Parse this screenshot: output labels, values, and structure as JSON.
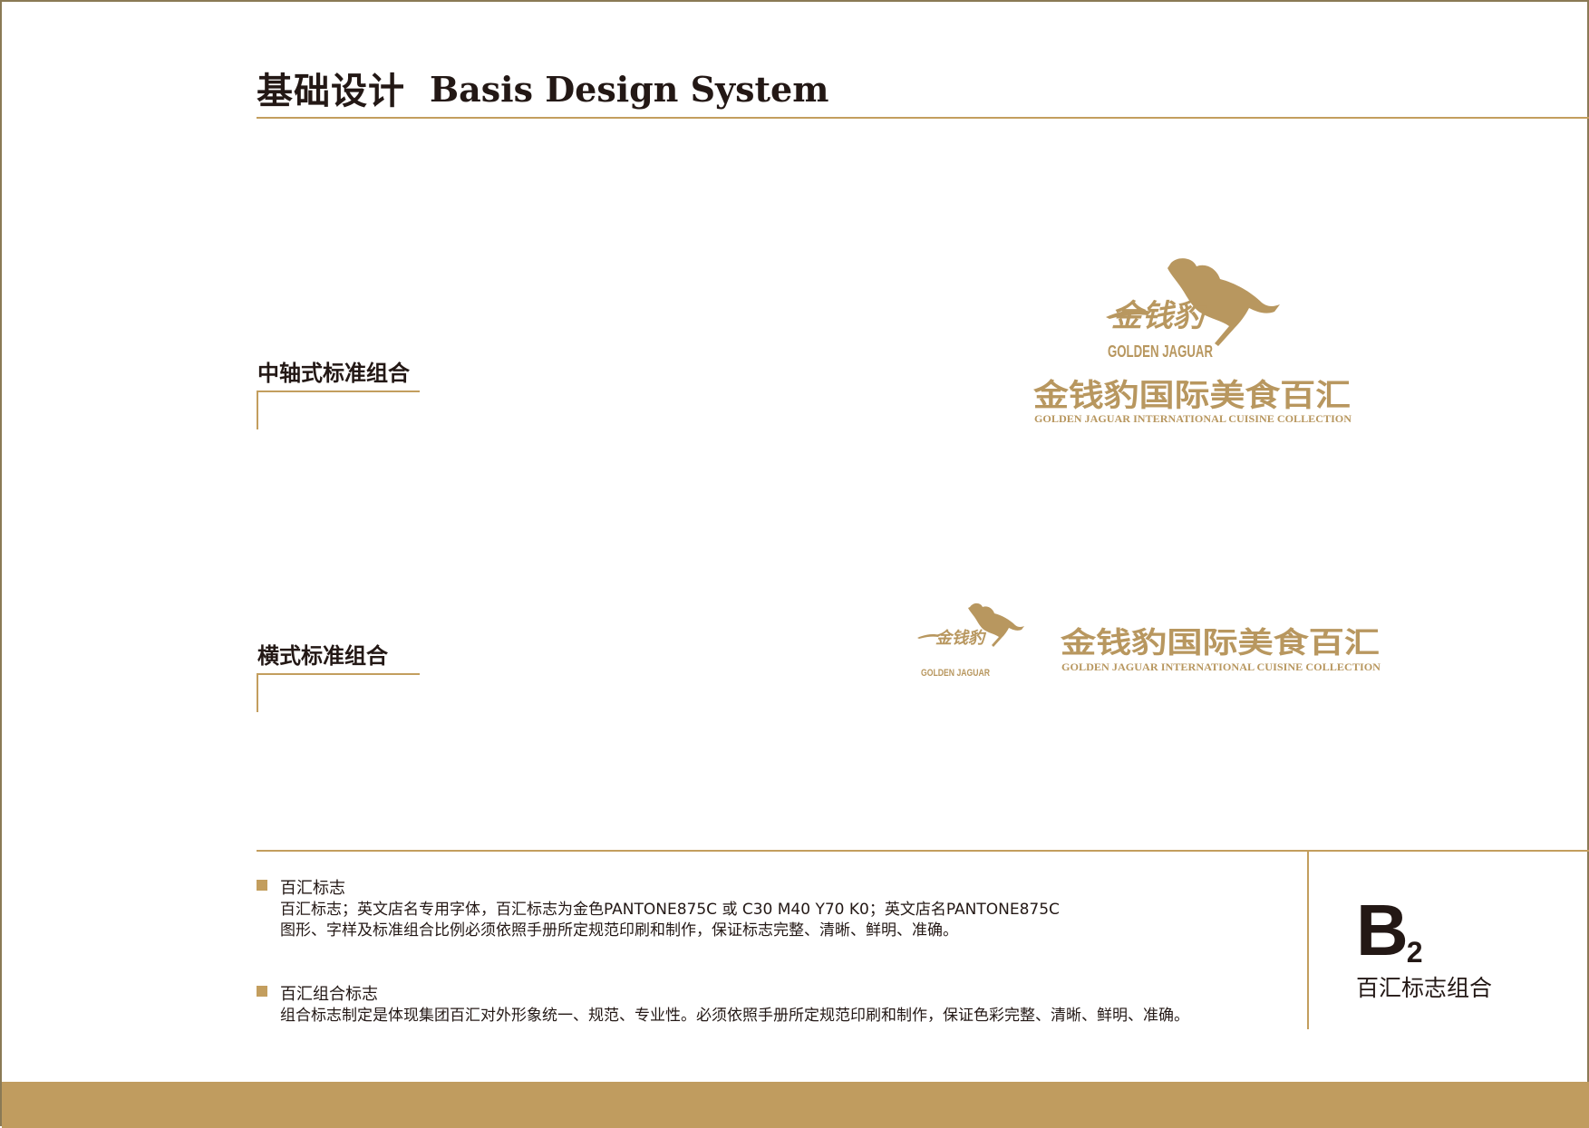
{
  "header": {
    "title_cn": "基础设计",
    "title_en": "Basis Design System"
  },
  "sections": {
    "vertical": {
      "title": "中轴式标准组合"
    },
    "horizontal": {
      "title": "横式标准组合"
    }
  },
  "logo": {
    "mark_cn": "金钱豹",
    "mark_en": "GOLDEN JAGUAR",
    "name_cn": "金钱豹国际美食百汇",
    "name_en": "GOLDEN JAGUAR INTERNATIONAL CUISINE COLLECTION",
    "icon": "jaguar-icon",
    "color": "#b8975f"
  },
  "notes": [
    {
      "title": "百汇标志",
      "lines": [
        "百汇标志；英文店名专用字体，百汇标志为金色PANTONE875C 或 C30 M40 Y70 K0；英文店名PANTONE875C",
        "图形、字样及标准组合比例必须依照手册所定规范印刷和制作，保证标志完整、清晰、鲜明、准确。"
      ]
    },
    {
      "title": "百汇组合标志",
      "lines": [
        "组合标志制定是体现集团百汇对外形象统一、规范、专业性。必须依照手册所定规范印刷和制作，保证色彩完整、清晰、鲜明、准确。"
      ]
    }
  ],
  "page_code": {
    "letter": "B",
    "number": "2",
    "name": "百汇标志组合"
  },
  "colors": {
    "accent": "#c39e5e",
    "footer": "#c09c5f",
    "border": "#8a7a55",
    "text": "#231815"
  }
}
